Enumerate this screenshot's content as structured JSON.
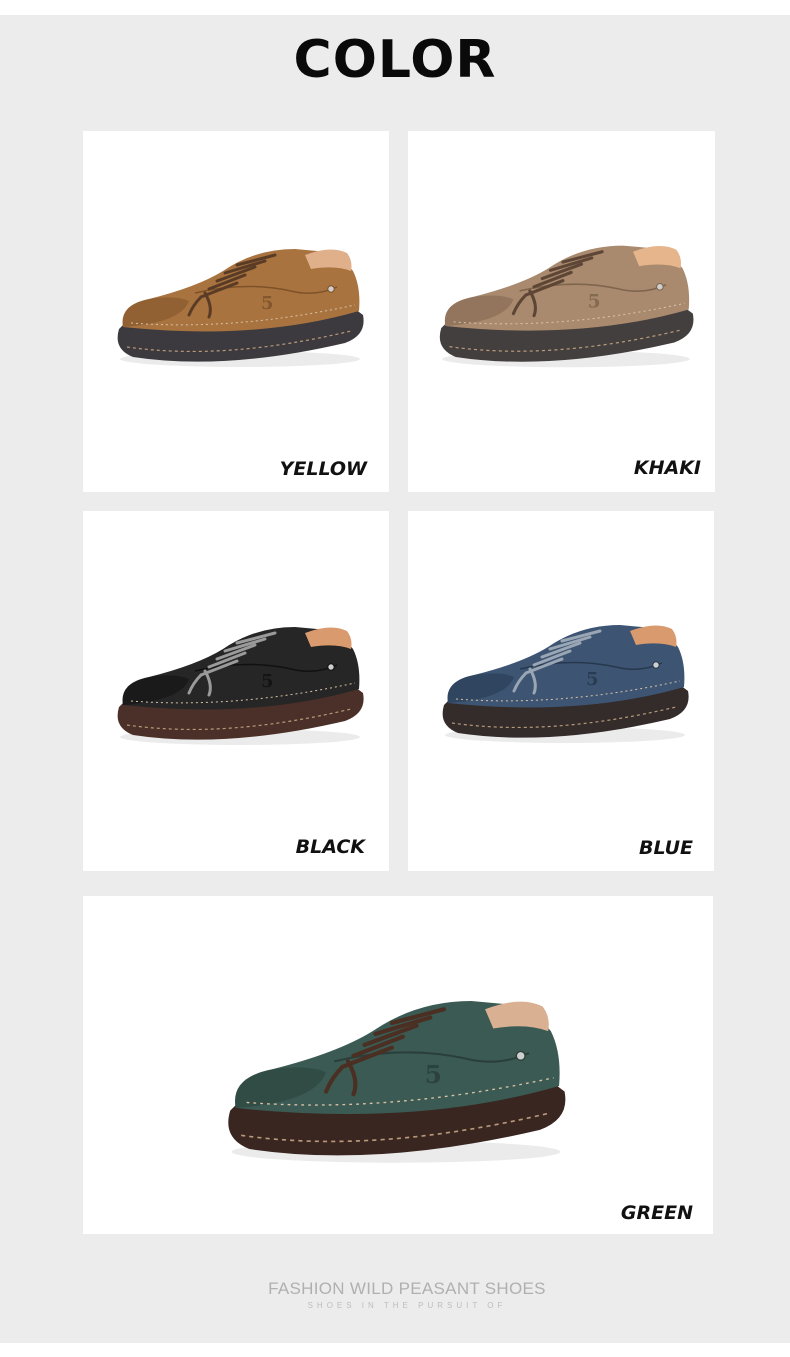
{
  "header": {
    "title": "COLOR"
  },
  "variants": [
    {
      "label": "YELLOW",
      "upper": "#a8733f",
      "upper_dark": "#7e5229",
      "lining": "#e0b08a",
      "sole": "#3c3a3e",
      "lace": "#5a3c26"
    },
    {
      "label": "KHAKI",
      "upper": "#a98a6e",
      "upper_dark": "#7f654e",
      "lining": "#e6b58c",
      "sole": "#433f3e",
      "lace": "#5e4636"
    },
    {
      "label": "BLACK",
      "upper": "#262626",
      "upper_dark": "#111111",
      "lining": "#d99a6e",
      "sole": "#4a3028",
      "lace": "#9a9a9a"
    },
    {
      "label": "BLUE",
      "upper": "#3d5573",
      "upper_dark": "#27384e",
      "lining": "#d99a6e",
      "sole": "#332c2a",
      "lace": "#9aa6b4"
    },
    {
      "label": "GREEN",
      "upper": "#3b5a53",
      "upper_dark": "#2a3f3a",
      "lining": "#d9b091",
      "sole": "#3a2620",
      "lace": "#4a2f22"
    }
  ],
  "footer": {
    "title": "FASHION WILD PEASANT SHOES",
    "subtitle": "SHOES IN THE PURSUIT OF"
  }
}
